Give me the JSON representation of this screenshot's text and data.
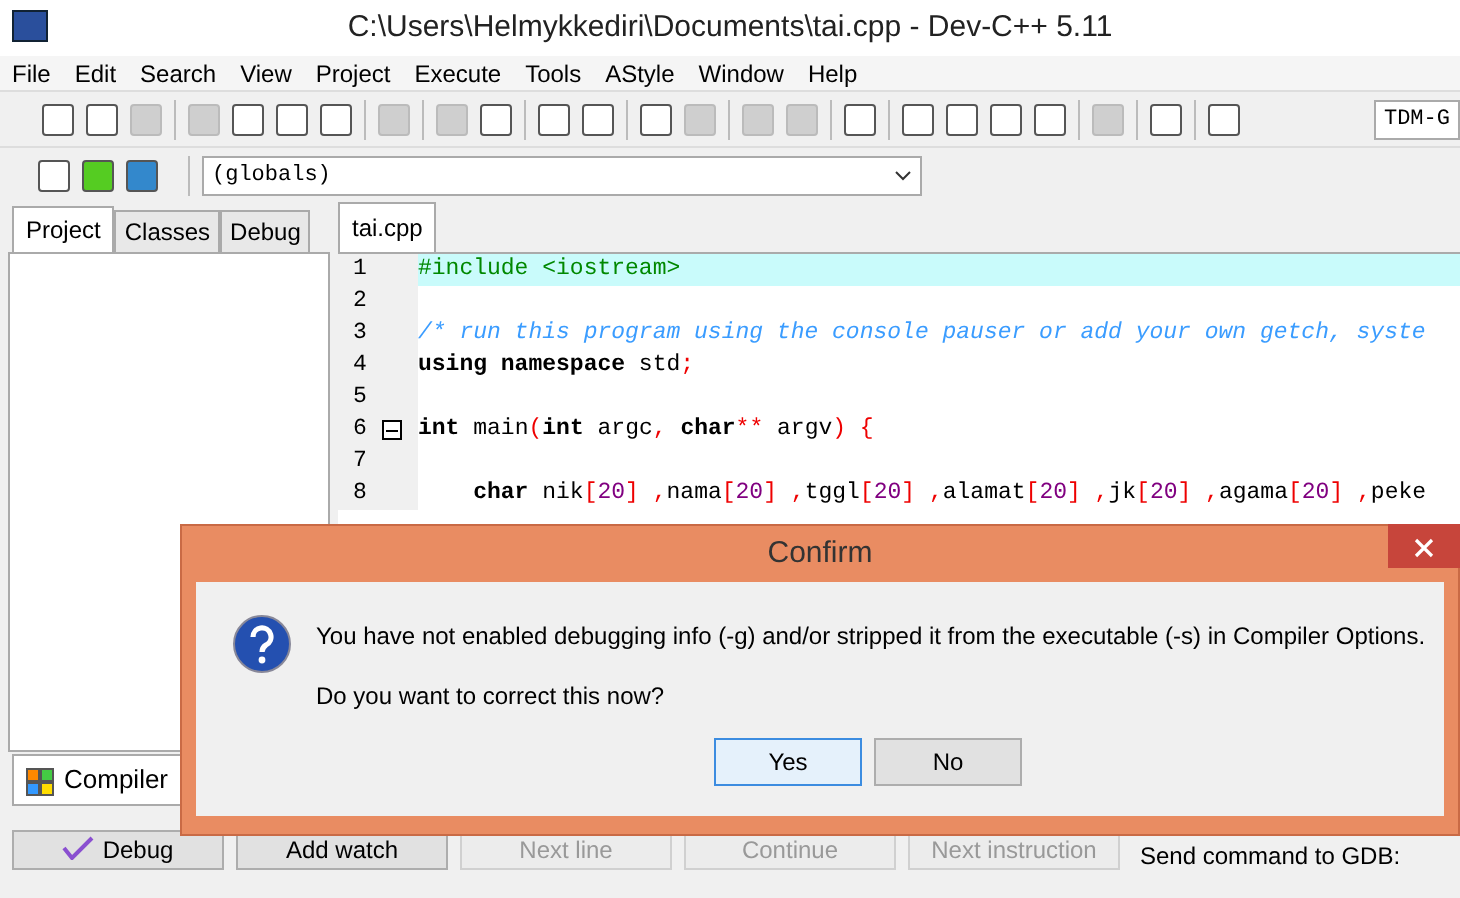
{
  "window": {
    "title": "C:\\Users\\Helmykkediri\\Documents\\tai.cpp - Dev-C++ 5.11"
  },
  "menu": [
    "File",
    "Edit",
    "Search",
    "View",
    "Project",
    "Execute",
    "Tools",
    "AStyle",
    "Window",
    "Help"
  ],
  "toolbar": [
    {
      "disabled": false
    },
    {
      "disabled": false
    },
    {
      "disabled": true
    },
    {
      "disabled": true
    },
    {
      "disabled": false
    },
    {
      "disabled": false
    },
    {
      "disabled": false
    },
    {
      "disabled": true
    },
    {
      "disabled": true
    },
    {
      "disabled": false
    },
    {
      "disabled": false
    },
    {
      "disabled": false
    },
    {
      "disabled": false
    },
    {
      "disabled": true
    },
    {
      "disabled": true
    },
    {
      "disabled": true
    },
    {
      "disabled": false
    },
    {
      "disabled": false
    },
    {
      "disabled": false
    },
    {
      "disabled": false
    },
    {
      "disabled": false
    },
    {
      "disabled": true
    },
    {
      "disabled": false
    },
    {
      "disabled": false
    }
  ],
  "compiler_combo": {
    "value": "TDM-G"
  },
  "scope_combo": {
    "value": "(globals)"
  },
  "left_tabs": [
    {
      "label": "Project",
      "selected": true
    },
    {
      "label": "Classes",
      "selected": false
    },
    {
      "label": "Debug",
      "selected": false
    }
  ],
  "editor_tabs": [
    {
      "label": "tai.cpp",
      "selected": true
    }
  ],
  "code": [
    {
      "number": "1",
      "highlighted": true,
      "fold": false,
      "tokens": [
        {
          "kind": "preproc",
          "text": "#include <iostream>"
        }
      ]
    },
    {
      "number": "2",
      "fold": false
    },
    {
      "number": "3",
      "fold": false,
      "tokens": [
        {
          "kind": "comment",
          "text": "/* run this program using the console pauser or add your own getch, syste"
        }
      ]
    },
    {
      "number": "4",
      "fold": false,
      "tokens": [
        {
          "kind": "keyword",
          "text": "using namespace"
        },
        {
          "kind": "plain",
          "text": " std"
        },
        {
          "kind": "symbol",
          "text": ";"
        }
      ]
    },
    {
      "number": "5",
      "fold": false
    },
    {
      "number": "6",
      "fold": true,
      "tokens": [
        {
          "kind": "keyword",
          "text": "int"
        },
        {
          "kind": "plain",
          "text": " main"
        },
        {
          "kind": "symbol",
          "text": "("
        },
        {
          "kind": "keyword",
          "text": "int"
        },
        {
          "kind": "plain",
          "text": " argc"
        },
        {
          "kind": "symbol",
          "text": ", "
        },
        {
          "kind": "keyword",
          "text": "char"
        },
        {
          "kind": "symbol",
          "text": "**"
        },
        {
          "kind": "plain",
          "text": " argv"
        },
        {
          "kind": "symbol",
          "text": ") {"
        }
      ]
    },
    {
      "number": "7",
      "fold": false
    },
    {
      "number": "8",
      "fold": false,
      "tokens": [
        {
          "kind": "keyword",
          "text": "    char"
        },
        {
          "kind": "plain",
          "text": " nik"
        },
        {
          "kind": "symbol",
          "text": "["
        },
        {
          "kind": "number",
          "text": "20"
        },
        {
          "kind": "symbol",
          "text": "] ,"
        },
        {
          "kind": "plain",
          "text": "nama"
        },
        {
          "kind": "symbol",
          "text": "["
        },
        {
          "kind": "number",
          "text": "20"
        },
        {
          "kind": "symbol",
          "text": "] ,"
        },
        {
          "kind": "plain",
          "text": "tggl"
        },
        {
          "kind": "symbol",
          "text": "["
        },
        {
          "kind": "number",
          "text": "20"
        },
        {
          "kind": "symbol",
          "text": "] ,"
        },
        {
          "kind": "plain",
          "text": "alamat"
        },
        {
          "kind": "symbol",
          "text": "["
        },
        {
          "kind": "number",
          "text": "20"
        },
        {
          "kind": "symbol",
          "text": "] ,"
        },
        {
          "kind": "plain",
          "text": "jk"
        },
        {
          "kind": "symbol",
          "text": "["
        },
        {
          "kind": "number",
          "text": "20"
        },
        {
          "kind": "symbol",
          "text": "] ,"
        },
        {
          "kind": "plain",
          "text": "agama"
        },
        {
          "kind": "symbol",
          "text": "["
        },
        {
          "kind": "number",
          "text": "20"
        },
        {
          "kind": "symbol",
          "text": "] ,"
        },
        {
          "kind": "plain",
          "text": "peke"
        }
      ]
    }
  ],
  "bottom_tabs": [
    {
      "label": "Compiler",
      "selected": true
    }
  ],
  "debug_buttons": [
    {
      "label": "Debug",
      "disabled": false
    },
    {
      "label": "Add watch",
      "disabled": false
    },
    {
      "label": "Next line",
      "disabled": true
    },
    {
      "label": "Continue",
      "disabled": true
    },
    {
      "label": "Next instruction",
      "disabled": true
    }
  ],
  "gdb_label": "Send command to GDB:",
  "dialog": {
    "title": "Confirm",
    "message": "You have not enabled debugging info (-g) and/or stripped it from the executable (-s) in Compiler Options.",
    "question": "Do you want to correct this now?",
    "buttons": [
      {
        "label": "Yes",
        "selected": true
      },
      {
        "label": "No",
        "selected": false
      }
    ]
  }
}
